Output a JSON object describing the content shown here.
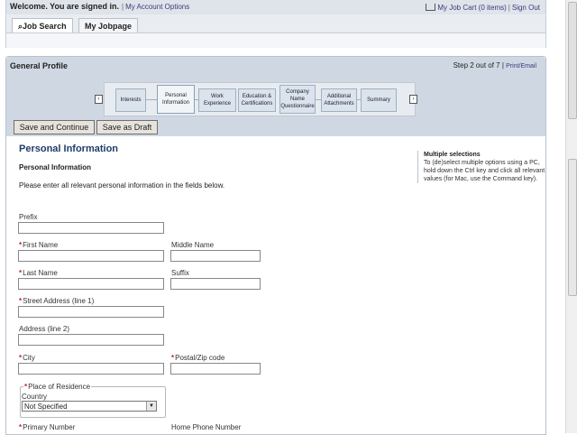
{
  "header": {
    "welcome": "Welcome. You are signed in.",
    "account_options": "My Account Options",
    "job_cart": "My Job Cart (0 items)",
    "sign_out": "Sign Out",
    "tabs": [
      {
        "label": "Job Search",
        "icon": "magnifier-icon"
      },
      {
        "label": "My Jobpage"
      }
    ]
  },
  "profile": {
    "title": "General Profile",
    "step_info": "Step 2 out of 7",
    "print_email": "Print/Email",
    "wizard_steps": [
      {
        "label": "Interests"
      },
      {
        "label": "Personal Information",
        "active": true
      },
      {
        "label": "Work Experience"
      },
      {
        "label": "Education & Certifications"
      },
      {
        "label": "Company Name Questionnaire"
      },
      {
        "label": "Additional Attachments"
      },
      {
        "label": "Summary"
      }
    ],
    "buttons": {
      "save_continue": "Save and Continue",
      "save_draft": "Save as Draft"
    }
  },
  "form": {
    "section_title": "Personal Information",
    "subtitle": "Personal Information",
    "description": "Please enter all relevant personal information in the fields below.",
    "help_title": "Multiple selections",
    "help_text": "To (de)select multiple options using a PC, hold down the Ctrl key and click all relevant values (for Mac, use the Command key).",
    "required_mark": "*",
    "labels": {
      "prefix": "Prefix",
      "first_name": "First Name",
      "middle_name": "Middle Name",
      "last_name": "Last Name",
      "suffix": "Suffix",
      "street1": "Street Address (line 1)",
      "address2": "Address (line 2)",
      "city": "City",
      "postal": "Postal/Zip code",
      "residence": "Place of Residence",
      "country": "Country",
      "primary_number": "Primary Number",
      "home_phone": "Home Phone Number"
    },
    "country_value": "Not Specified"
  }
}
